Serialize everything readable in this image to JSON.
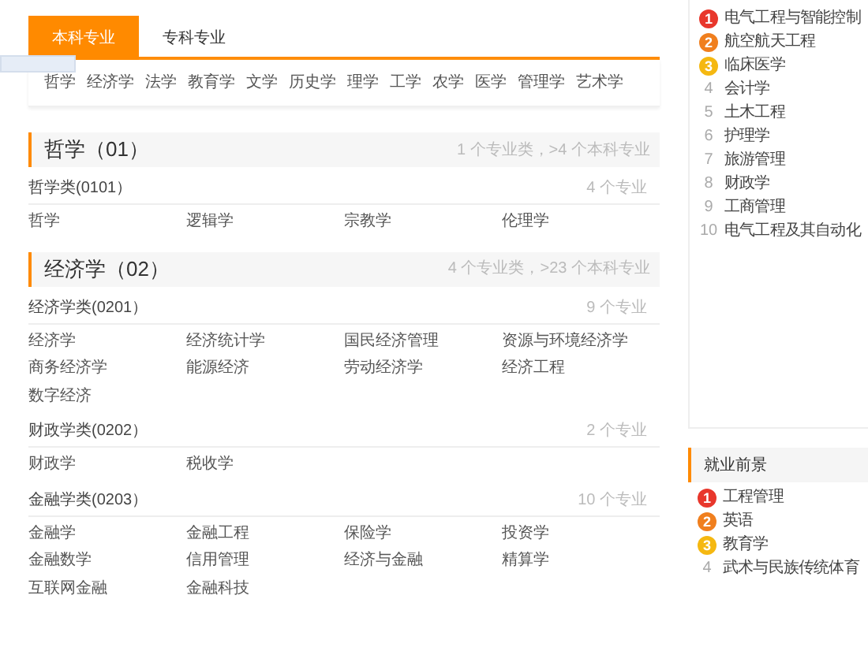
{
  "tabs": [
    {
      "label": "本科专业",
      "selected": true
    },
    {
      "label": "专科专业",
      "selected": false
    }
  ],
  "disciplines": [
    "哲学",
    "经济学",
    "法学",
    "教育学",
    "文学",
    "历史学",
    "理学",
    "工学",
    "农学",
    "医学",
    "管理学",
    "艺术学"
  ],
  "sections": [
    {
      "title": "哲学（01）",
      "summary": "1 个专业类，>4 个本科专业",
      "groups": [
        {
          "title": "哲学类(0101）",
          "count": "4 个专业",
          "majors": [
            "哲学",
            "逻辑学",
            "宗教学",
            "伦理学"
          ]
        }
      ]
    },
    {
      "title": "经济学（02）",
      "summary": "4 个专业类，>23 个本科专业",
      "groups": [
        {
          "title": "经济学类(0201）",
          "count": "9 个专业",
          "majors": [
            "经济学",
            "经济统计学",
            "国民经济管理",
            "资源与环境经济学",
            "商务经济学",
            "能源经济",
            "劳动经济学",
            "经济工程",
            "数字经济"
          ]
        },
        {
          "title": "财政学类(0202）",
          "count": "2 个专业",
          "majors": [
            "财政学",
            "税收学"
          ]
        },
        {
          "title": "金融学类(0203）",
          "count": "10 个专业",
          "majors": [
            "金融学",
            "金融工程",
            "保险学",
            "投资学",
            "金融数学",
            "信用管理",
            "经济与金融",
            "精算学",
            "互联网金融",
            "金融科技"
          ]
        }
      ]
    }
  ],
  "ranking": [
    {
      "rank": "1",
      "name": "电气工程与智能控制",
      "kind": "hot",
      "color": "#e8372c"
    },
    {
      "rank": "2",
      "name": "航空航天工程",
      "kind": "hot",
      "color": "#f07f1e"
    },
    {
      "rank": "3",
      "name": "临床医学",
      "kind": "hot",
      "color": "#f5b811"
    },
    {
      "rank": "4",
      "name": "会计学",
      "kind": "plain"
    },
    {
      "rank": "5",
      "name": "土木工程",
      "kind": "plain"
    },
    {
      "rank": "6",
      "name": "护理学",
      "kind": "plain"
    },
    {
      "rank": "7",
      "name": "旅游管理",
      "kind": "plain"
    },
    {
      "rank": "8",
      "name": "财政学",
      "kind": "plain"
    },
    {
      "rank": "9",
      "name": "工商管理",
      "kind": "plain"
    },
    {
      "rank": "10",
      "name": "电气工程及其自动化",
      "kind": "plain"
    }
  ],
  "prospects": {
    "title": "就业前景",
    "items": [
      {
        "rank": "1",
        "name": "工程管理",
        "kind": "hot",
        "color": "#e8372c"
      },
      {
        "rank": "2",
        "name": "英语",
        "kind": "hot",
        "color": "#f07f1e"
      },
      {
        "rank": "3",
        "name": "教育学",
        "kind": "hot",
        "color": "#f5b811"
      },
      {
        "rank": "4",
        "name": "武术与民族传统体育",
        "kind": "plain"
      }
    ]
  }
}
